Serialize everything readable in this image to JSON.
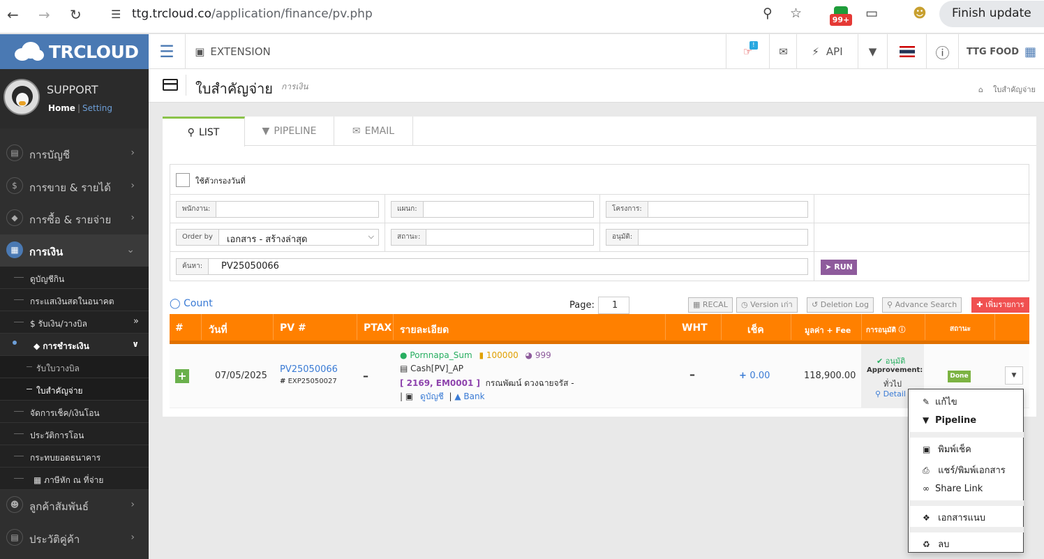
{
  "browser": {
    "url_host": "ttg.trcloud.co",
    "url_path": "/application/finance/pv.php",
    "ext_badge": "99+",
    "finish_update": "Finish update"
  },
  "app": {
    "logo": "TRCLOUD",
    "topbar": {
      "extension": "EXTENSION",
      "notif_badge": "!",
      "api": "API",
      "company": "TTG FOOD"
    }
  },
  "sidebar": {
    "user": "SUPPORT",
    "home": "Home",
    "setting": "Setting",
    "menu": [
      {
        "label": "การบัญชี",
        "icon": "book-icon"
      },
      {
        "label": "การขาย & รายได้",
        "icon": "dollar-icon"
      },
      {
        "label": "การซื้อ & รายจ่าย",
        "icon": "cart-icon"
      },
      {
        "label": "การเงิน",
        "icon": "calendar-icon"
      }
    ],
    "sub_items": [
      "ดูบัญชีกิน",
      "กระแสเงินสดในอนาคต",
      "$ รับเงิน/วางบิล",
      "การชำระเงิน",
      "รับใบวางบิล",
      "ใบสำคัญจ่าย",
      "จัดการเช็ค/เงินโอน",
      "ประวัติการโอน",
      "กระทบยอดธนาคาร",
      "ภาษีหัก ณ ที่จ่าย"
    ],
    "bottom_menu": [
      {
        "label": "ลูกค้าสัมพันธ์",
        "icon": "users-icon"
      },
      {
        "label": "ประวัติคู่ค้า",
        "icon": "contact-icon"
      }
    ]
  },
  "page": {
    "title": "ใบสำคัญจ่าย",
    "subtitle": "การเงิน",
    "breadcrumb": "ใบสำคัญจ่าย"
  },
  "tabs": {
    "list": "LIST",
    "pipeline": "PIPELINE",
    "email": "EMAIL"
  },
  "filter": {
    "use_date": "ใช้ตัวกรองวันที่",
    "employee_label": "พนักงาน:",
    "dept_label": "แผนก:",
    "project_label": "โครงการ:",
    "orderby_label": "Order by",
    "orderby_value": "เอกสาร - สร้างล่าสุด",
    "status_label": "สถานะ:",
    "approve_label": "อนุมัติ:",
    "search_label": "ค้นหา:",
    "search_value": "PV25050066",
    "run": "RUN"
  },
  "toolbar": {
    "count": "Count",
    "page_label": "Page:",
    "page_value": "1",
    "recal": "RECAL",
    "version": "Version เก่า",
    "deletion_log": "Deletion Log",
    "advance_search": "Advance Search",
    "add": "เพิ่มรายการ"
  },
  "table": {
    "headers": [
      "#",
      "วันที่",
      "PV #",
      "PTAX",
      "รายละเอียด",
      "WHT",
      "เช็ค",
      "มูลค่า + Fee",
      "การอนุมัติ",
      "สถานะ"
    ],
    "row": {
      "date": "07/05/2025",
      "pv_no": "PV25050066",
      "exp_no": "EXP25050027",
      "ptax": "–",
      "user": "Pornnapa_Sum",
      "code1": "100000",
      "code2": "999",
      "account": "Cash[PV]_AP",
      "ref": "[ 2169, EM0001 ]",
      "payee": "กรณพัฒน์ ดวงฉายจรัส -",
      "view_account": "ดูบัญชี",
      "bank": "Bank",
      "wht": "–",
      "cheque": "0.00",
      "amount": "118,900.00",
      "approved": "อนุมัติ",
      "approvement": "Approvement:",
      "approval_type": "ทั่วไป",
      "detail": "Detail",
      "status": "Done"
    }
  },
  "dropdown": {
    "edit": "แก้ไข",
    "pipeline": "Pipeline",
    "print_cheque": "พิมพ์เช็ค",
    "share_print": "แชร์/พิมพ์เอกสาร",
    "share_link": "Share Link",
    "attachments": "เอกสารแนบ",
    "delete": "ลบ"
  },
  "colors": {
    "brand": "#4a79b3",
    "table_header": "#ff8000",
    "run": "#8e5b9c",
    "add": "#f05050",
    "done": "#7cb342"
  }
}
